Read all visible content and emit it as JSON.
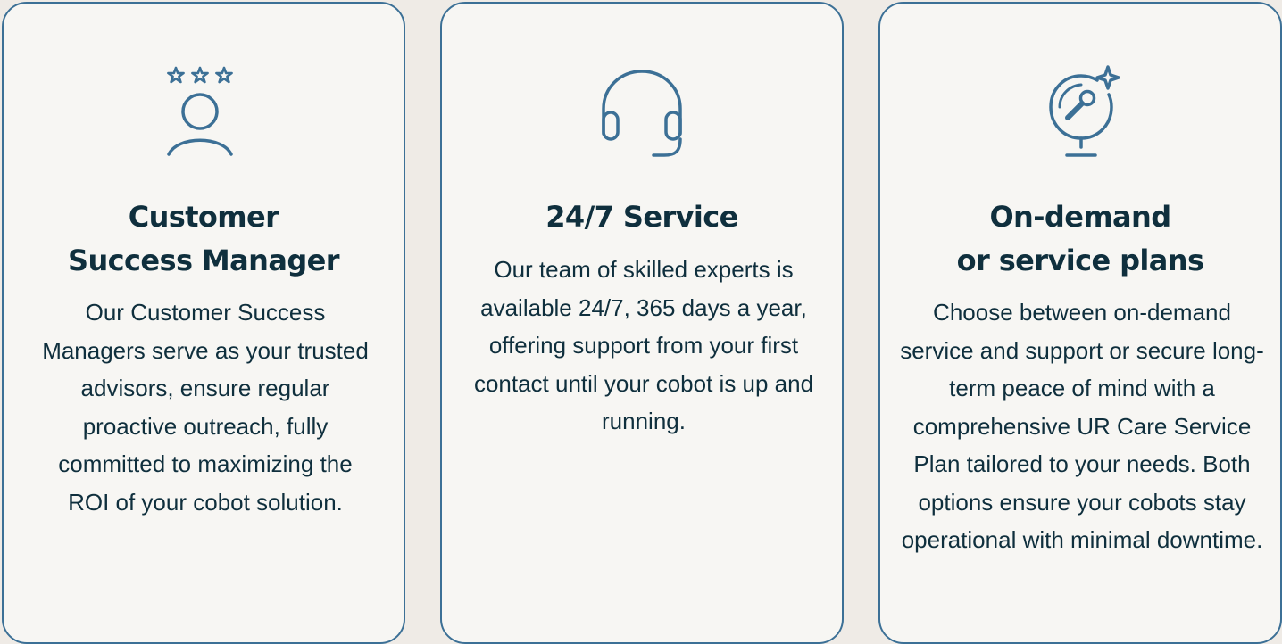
{
  "colors": {
    "page_background": "#efebe6",
    "card_background": "#f7f6f3",
    "card_border": "#3c7096",
    "icon_stroke": "#3c7096",
    "text": "#0f2f3d"
  },
  "cards": [
    {
      "icon": "customer-success-star-person-icon",
      "title_line1": "Customer",
      "title_line2": "Success Manager",
      "text": "Our Customer Success Managers serve as your trusted advisors, ensure regular proactive outreach, fully committed to maximizing the ROI of your cobot solution."
    },
    {
      "icon": "headset-icon",
      "title_line1": "24/7 Service",
      "text": "Our team of skilled experts is available 24/7, 365 days a year, offering support from your first contact until your cobot is up and running."
    },
    {
      "icon": "wrench-globe-sparkle-icon",
      "title_line1": "On-demand",
      "title_line2": "or service plans",
      "text": "Choose between on-demand service and support or secure long-term peace of mind with a comprehensive UR Care Service Plan tailored to your needs. Both options ensure your cobots stay operational with minimal downtime."
    }
  ]
}
